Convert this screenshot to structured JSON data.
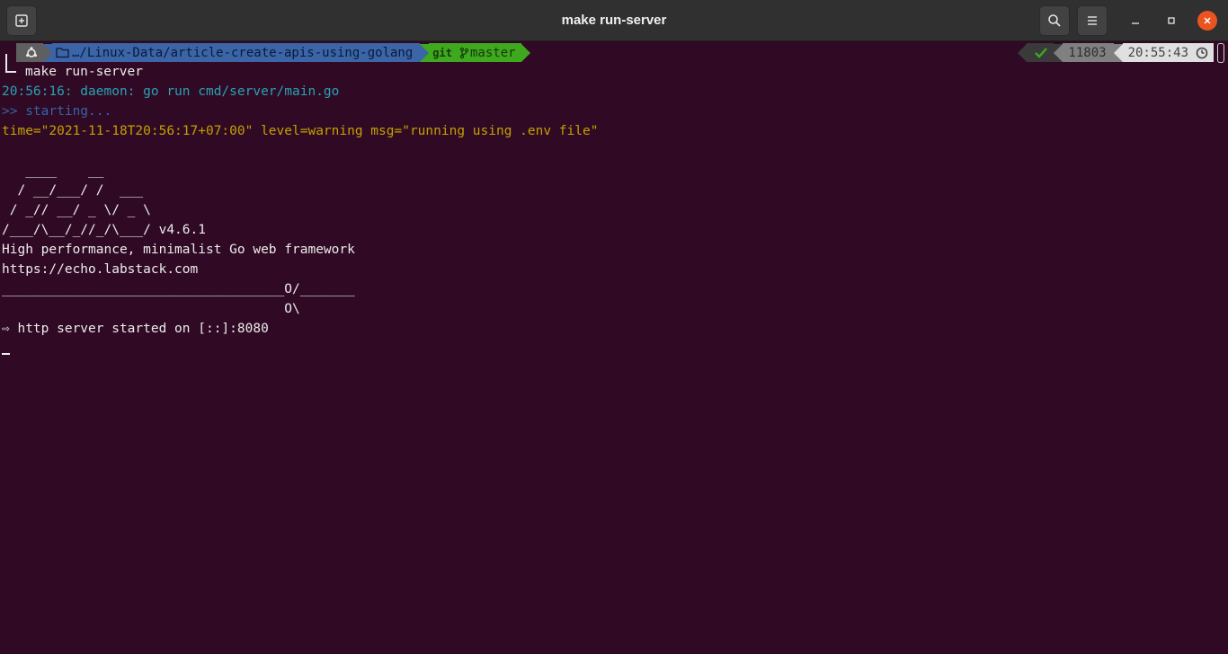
{
  "window": {
    "title": "make run-server"
  },
  "prompt": {
    "path": "…/Linux-Data/article-create-apis-using-golang",
    "vcs": "git",
    "branch": "master",
    "history_count": "11803",
    "time": "20:55:43"
  },
  "command": "make run-server",
  "output": {
    "daemon": "20:56:16: daemon: go run cmd/server/main.go",
    "starting": ">> starting...",
    "env_warning": "time=\"2021-11-18T20:56:17+07:00\" level=warning msg=\"running using .env file\"",
    "banner_1": "   ____    __",
    "banner_2": "  / __/___/ /  ___",
    "banner_3": " / _// __/ _ \\/ _ \\",
    "banner_4": "/___/\\__/_//_/\\___/ v4.6.1",
    "tagline": "High performance, minimalist Go web framework",
    "url": "https://echo.labstack.com",
    "divider_1": "____________________________________O/_______",
    "divider_2": "                                    O\\",
    "started": "⇨ http server started on [::]:8080"
  },
  "colors": {
    "terminal_bg": "#300a24",
    "titlebar_bg": "#303030",
    "close_button": "#e95420"
  },
  "icons": {
    "new_tab": "new-tab-icon",
    "search": "search-icon",
    "menu": "hamburger-menu-icon",
    "minimize": "minimize-icon",
    "maximize": "maximize-icon",
    "close": "close-icon",
    "os": "ubuntu-logo-icon",
    "folder": "folder-icon",
    "branch": "git-branch-icon",
    "status_ok": "checkmark-icon",
    "clock": "clock-icon"
  }
}
